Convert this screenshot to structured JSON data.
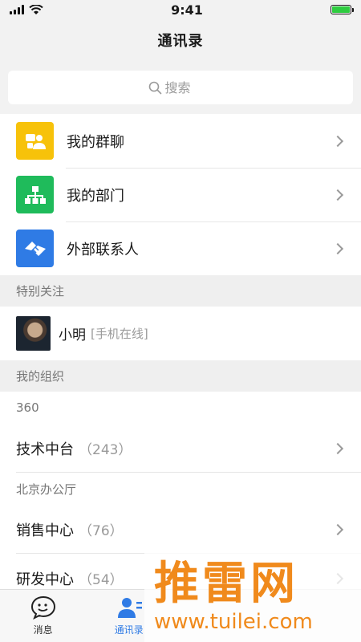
{
  "status_bar": {
    "time": "9:41"
  },
  "header": {
    "title": "通讯录"
  },
  "search": {
    "placeholder": "搜索"
  },
  "menu": [
    {
      "label": "我的群聊",
      "icon": "group-chat-icon",
      "color": "#f7c20a"
    },
    {
      "label": "我的部门",
      "icon": "department-tree-icon",
      "color": "#1fbb5b"
    },
    {
      "label": "外部联系人",
      "icon": "handshake-icon",
      "color": "#2f7be5"
    }
  ],
  "sections": {
    "favorites": "特别关注",
    "my_org": "我的组织"
  },
  "favorites": [
    {
      "name": "小明",
      "status": "[手机在线]"
    }
  ],
  "orgs": [
    {
      "group": "360",
      "items": [
        {
          "label": "技术中台",
          "count": "（243）"
        }
      ]
    },
    {
      "group": "北京办公厅",
      "items": [
        {
          "label": "销售中心",
          "count": "（76）"
        },
        {
          "label": "研发中心",
          "count": "（54）"
        }
      ]
    }
  ],
  "tab_bar": [
    {
      "label": "消息",
      "icon": "chat-bubble-icon",
      "active": false
    },
    {
      "label": "通讯录",
      "icon": "contacts-icon",
      "active": true
    }
  ],
  "watermark": {
    "main": "推雷网",
    "sub": "www.tuilei.com"
  },
  "colors": {
    "accent": "#2f7be5",
    "watermark": "#f08a1c"
  }
}
